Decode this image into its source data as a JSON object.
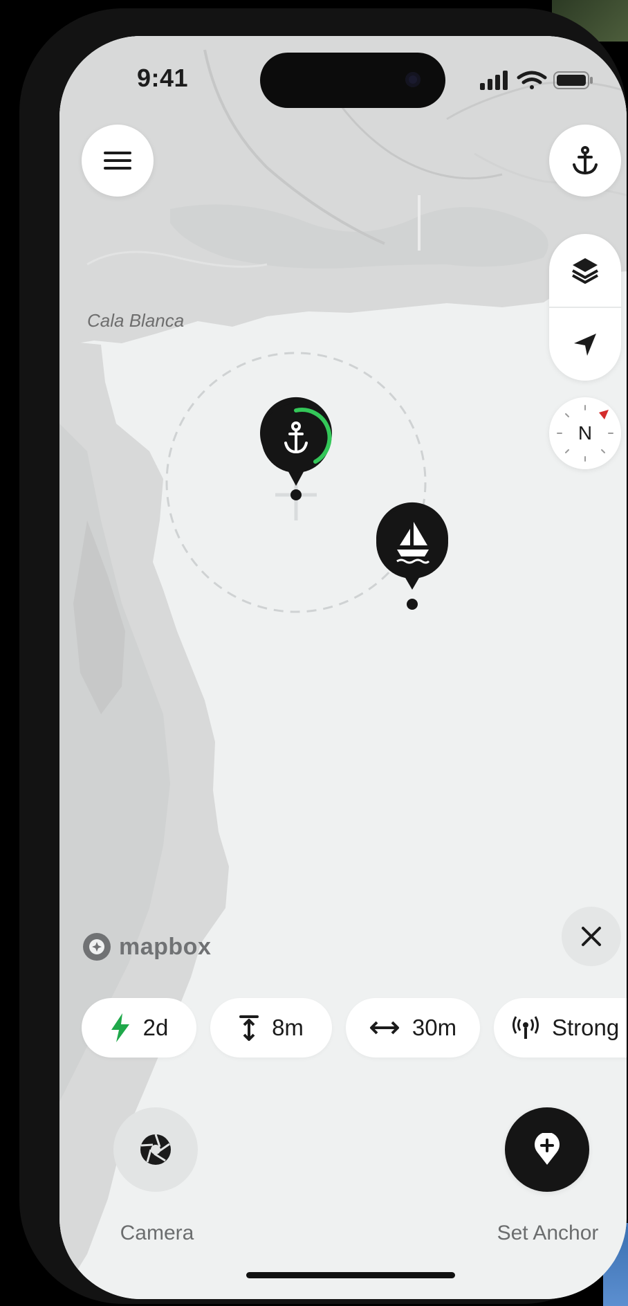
{
  "status_bar": {
    "time": "9:41"
  },
  "map": {
    "place_label": "Cala Blanca",
    "attribution": "mapbox"
  },
  "icons": {
    "menu": "hamburger-icon",
    "anchor": "anchor-icon",
    "layers": "layers-icon",
    "location": "location-arrow-icon",
    "compass": "compass-icon",
    "close": "close-icon",
    "boat": "sailboat-icon",
    "camera": "camera-aperture-icon",
    "set_anchor": "map-pin-plus-icon"
  },
  "compass": {
    "label": "N"
  },
  "stats": [
    {
      "icon": "bolt-icon",
      "value": "2d"
    },
    {
      "icon": "depth-icon",
      "value": "8m"
    },
    {
      "icon": "range-icon",
      "value": "30m"
    },
    {
      "icon": "signal-icon",
      "value": "Strong"
    }
  ],
  "actions": {
    "camera_label": "Camera",
    "set_anchor_label": "Set Anchor"
  },
  "colors": {
    "accent_green": "#34c759",
    "bolt_green": "#1fa84a",
    "marker_dark": "#151515",
    "compass_red": "#d42b2b"
  }
}
